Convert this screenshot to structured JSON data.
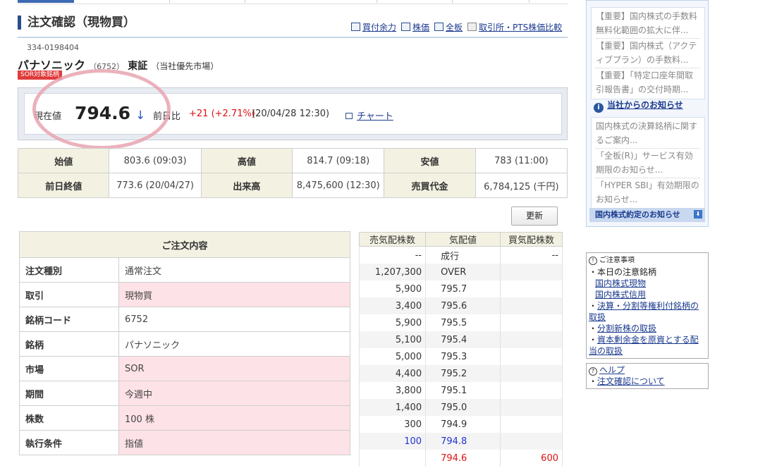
{
  "page_title": "注文確認（現物買）",
  "top_links": [
    "買付余力",
    "株価",
    "全板",
    "取引所・PTS株価比較"
  ],
  "account_no": "334-0198404",
  "stock": {
    "name": "パナソニック",
    "code": "（6752）",
    "exchange": "東証",
    "exchange_note": "（当社優先市場）",
    "badge": "SOR対象銘柄"
  },
  "price_panel": {
    "current_label": "現在値",
    "current_value": "794.6",
    "arrow": "↓",
    "prev_label": "前日比",
    "change": "+21 (+2.71%)",
    "timestamp": "(20/04/28 12:30)",
    "chart_link": "チャート"
  },
  "quote_table": [
    [
      {
        "h": "始値"
      },
      {
        "v": "803.6 (09:03)"
      },
      {
        "h": "高値"
      },
      {
        "v": "814.7 (09:18)"
      },
      {
        "h": "安値"
      },
      {
        "v": "783 (11:00)"
      }
    ],
    [
      {
        "h": "前日終値"
      },
      {
        "v": "773.6 (20/04/27)"
      },
      {
        "h": "出来高"
      },
      {
        "v": "8,475,600 (12:30)"
      },
      {
        "h": "売買代金"
      },
      {
        "v": "6,784,125 (千円)"
      }
    ]
  ],
  "refresh_button": "更新",
  "order": {
    "header": "ご注文内容",
    "rows": [
      {
        "label": "注文種別",
        "value": "通常注文",
        "pink": false
      },
      {
        "label": "取引",
        "value": "現物買",
        "pink": true
      },
      {
        "label": "銘柄コード",
        "value": "6752",
        "pink": false
      },
      {
        "label": "銘柄",
        "value": "パナソニック",
        "pink": false
      },
      {
        "label": "市場",
        "value": "SOR",
        "pink": true
      },
      {
        "label": "期間",
        "value": "今週中",
        "pink": true
      },
      {
        "label": "株数",
        "value": "100 株",
        "pink": true
      },
      {
        "label": "執行条件",
        "value": "指値",
        "pink": true
      }
    ]
  },
  "board": {
    "headers": [
      "売気配株数",
      "気配値",
      "買気配株数"
    ],
    "rows": [
      {
        "sell": "--",
        "price": "成行",
        "buy": "--"
      },
      {
        "sell": "1,207,300",
        "price": "OVER",
        "buy": ""
      },
      {
        "sell": "5,900",
        "price": "795.7",
        "buy": ""
      },
      {
        "sell": "3,400",
        "price": "795.6",
        "buy": ""
      },
      {
        "sell": "5,900",
        "price": "795.5",
        "buy": ""
      },
      {
        "sell": "5,100",
        "price": "795.4",
        "buy": ""
      },
      {
        "sell": "5,000",
        "price": "795.3",
        "buy": ""
      },
      {
        "sell": "4,400",
        "price": "795.2",
        "buy": ""
      },
      {
        "sell": "3,800",
        "price": "795.1",
        "buy": ""
      },
      {
        "sell": "1,400",
        "price": "795.0",
        "buy": ""
      },
      {
        "sell": "300",
        "price": "794.9",
        "buy": ""
      },
      {
        "sell": "100",
        "price": "794.8",
        "buy": "",
        "color": "blue"
      },
      {
        "sell": "",
        "price": "794.6",
        "buy": "600",
        "color": "red"
      }
    ]
  },
  "sidebar": {
    "news_top": [
      "【重要】国内株式の手数料無料化範囲の拡大に伴...",
      "【重要】国内株式（アクティブプラン）の手数料...",
      "【重要】「特定口座年間取引報告書」の交付時期..."
    ],
    "notice_heading": "当社からのお知らせ",
    "notices": [
      "国内株式の決算銘柄に関するご案内...",
      "「全板(R)」サービス有効期限のお知らせ...",
      "「HYPER SBI」有効期限のお知らせ..."
    ],
    "footer": "国内株式約定のお知らせ"
  },
  "caution": {
    "title": "ご注意事項",
    "today_label": "・本日の注意銘柄",
    "links": [
      "国内株式現物",
      "国内株式信用"
    ],
    "items": [
      "決算・分割等権利付銘柄の取扱",
      "分割新株の取扱",
      "資本剰余金を原資とする配当の取扱"
    ]
  },
  "help": {
    "title": "ヘルプ",
    "link": "注文確認について"
  }
}
